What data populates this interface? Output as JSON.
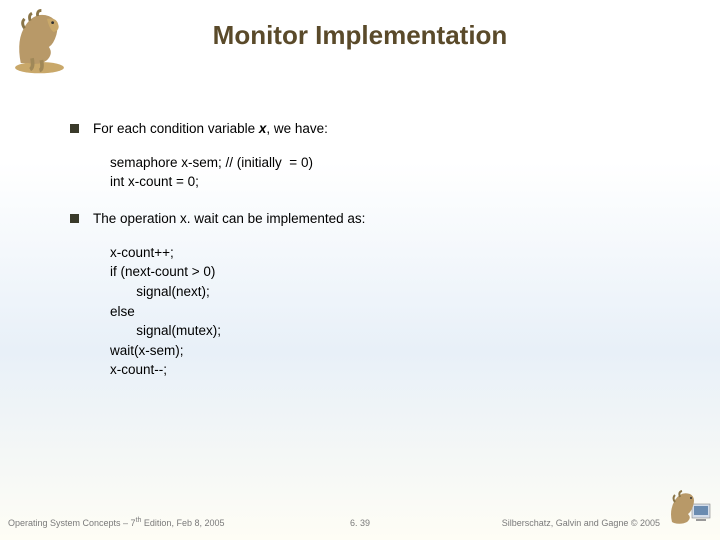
{
  "title": "Monitor Implementation",
  "bullet1_pre": "For each condition variable ",
  "bullet1_var": "x",
  "bullet1_post": ", we  have:",
  "code1": "semaphore x-sem; // (initially  = 0)\nint x-count = 0;",
  "bullet2": "The operation x. wait can be implemented as:",
  "code2": "x-count++;\nif (next-count > 0)\n       signal(next);\nelse\n       signal(mutex);\nwait(x-sem);\nx-count--;",
  "footer_left_pre": "Operating System Concepts – 7",
  "footer_left_sup": "th",
  "footer_left_post": " Edition, Feb 8, 2005",
  "footer_center": "6. 39",
  "footer_right": "Silberschatz, Galvin and Gagne © 2005"
}
